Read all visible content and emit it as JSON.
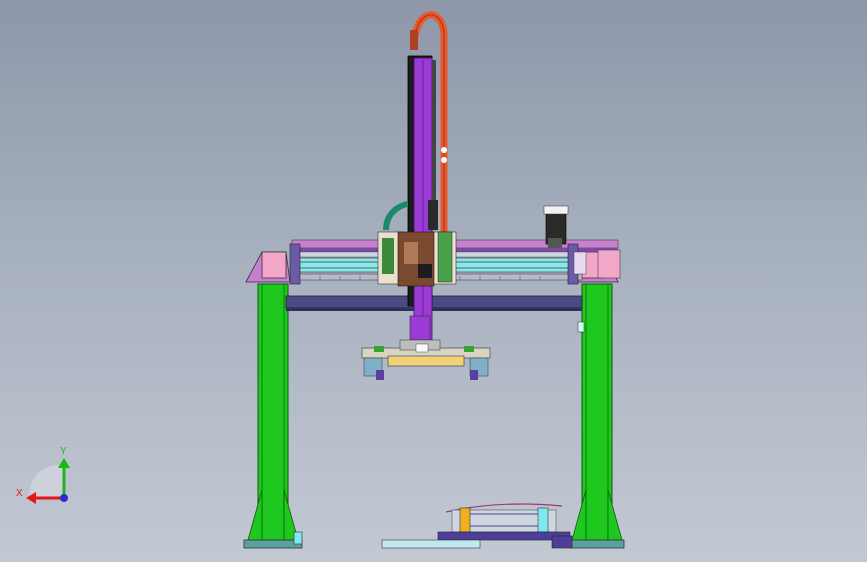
{
  "viewport": {
    "background_top": "#8d97a9",
    "background_bottom": "#c3c9d3"
  },
  "triad": {
    "x_label": "X",
    "y_label": "Y",
    "x_color": "#e01a1a",
    "y_color": "#18b818",
    "z_color": "#2a2ad8"
  },
  "colors": {
    "column": "#1ec81e",
    "column_dark": "#0e7a0e",
    "beam": "#4a4a86",
    "rail": "#c77fd0",
    "rail_light": "#8fe6e6",
    "vertical_axis": "#9b3bd6",
    "carriage": "#7a4a30",
    "cable": "#e8582a",
    "base_plate": "#4d3e9a",
    "fixture": "#f0d27a",
    "pink": "#f2a6c8",
    "motor": "#2a2a2a"
  }
}
